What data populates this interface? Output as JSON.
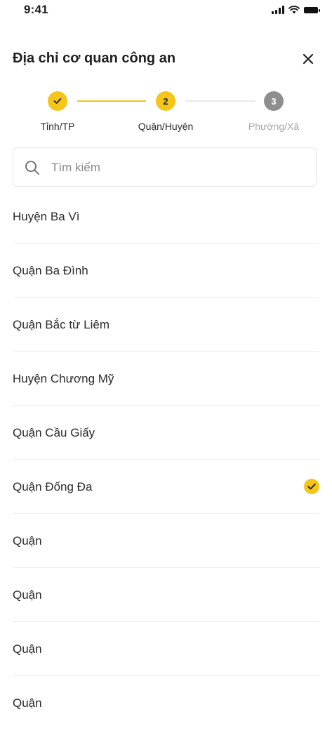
{
  "status": {
    "time": "9:41"
  },
  "header": {
    "title": "Địa chỉ cơ quan công an"
  },
  "steps": [
    {
      "label": "Tỉnh/TP",
      "state": "done"
    },
    {
      "label": "Quận/Huyện",
      "number": "2",
      "state": "active"
    },
    {
      "label": "Phường/Xã",
      "number": "3",
      "state": "pending"
    }
  ],
  "search": {
    "placeholder": "Tìm kiếm"
  },
  "districts": [
    "Huyện Ba Vì",
    "Quận Ba Đình",
    "Quận Bắc từ Liêm",
    "Huyện Chương Mỹ",
    "Quận Cầu Giấy",
    "Quận Đống Đa",
    "Quận",
    "Quận",
    "Quận",
    "Quận"
  ],
  "selected_district": "Quận Đống Đa",
  "colors": {
    "accent": "#F5C518",
    "pending": "#8E8E8E",
    "text": "#1f1f1f"
  }
}
